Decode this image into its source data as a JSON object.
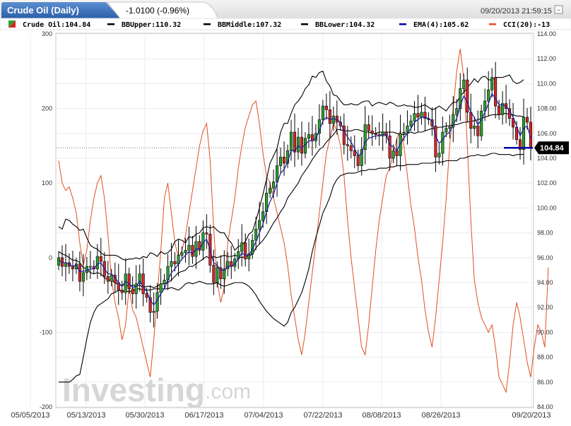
{
  "header": {
    "title": "Crude Oil (Daily)",
    "change": "-1.0100 (-0.96%)",
    "timestamp": "09/20/2013 21:59:15",
    "minimize_label": "−",
    "maximize_label": "□"
  },
  "legend": [
    {
      "label": "Crude Oil:104.84",
      "color": "#2ca02c",
      "color2": "#d62728"
    },
    {
      "label": "BBUpper:110.32",
      "color": "#000000"
    },
    {
      "label": "BBMiddle:107.32",
      "color": "#000000"
    },
    {
      "label": "BBLower:104.32",
      "color": "#000000"
    },
    {
      "label": "EMA(4):105.62",
      "color": "#0000aa"
    },
    {
      "label": "CCI(20):-13",
      "color": "#e05020"
    }
  ],
  "watermark": {
    "main": "Investing",
    "suffix": ".com"
  },
  "chart_data": {
    "type": "candlestick",
    "right_axis": {
      "ticks": [
        "114.00",
        "112.00",
        "110.00",
        "108.00",
        "106.00",
        "104.00",
        "102.00",
        "100.00",
        "98.00",
        "96.00",
        "94.00",
        "92.00",
        "90.00",
        "88.00",
        "86.00",
        "84.00"
      ],
      "range": [
        84,
        114
      ]
    },
    "left_axis": {
      "ticks": [
        "300",
        "200",
        "100",
        "0",
        "-100",
        "-200"
      ],
      "range": [
        -200,
        300
      ]
    },
    "x_ticks": [
      "05/05/2013",
      "05/13/2013",
      "05/30/2013",
      "06/17/2013",
      "07/04/2013",
      "07/22/2013",
      "08/08/2013",
      "08/26/2013",
      "09/20/2013"
    ],
    "last_price": "104.84",
    "last_price_value": 104.84,
    "last_price_color": "#0000aa",
    "colors": {
      "up": "#2ca02c",
      "down": "#d62728",
      "bb": "#000000",
      "ema": "#1a1aa0",
      "cci": "#e05020"
    },
    "series": [
      {
        "name": "Crude Oil",
        "close": [
          96.0,
          95.3,
          95.6,
          95.3,
          95.1,
          95.5,
          94.1,
          94.8,
          95.3,
          95.3,
          95.1,
          96.1,
          95.7,
          94.5,
          94.1,
          94.6,
          94.0,
          93.4,
          93.2,
          94.7,
          93.5,
          93.1,
          93.9,
          94.7,
          93.1,
          92.8,
          91.6,
          91.7,
          93.2,
          93.9,
          94.2,
          95.3,
          95.7,
          95.5,
          96.2,
          96.4,
          96.6,
          97.0,
          96.1,
          97.3,
          96.6,
          98.0,
          97.9,
          95.4,
          94.0,
          95.2,
          94.3,
          95.1,
          95.7,
          95.3,
          95.9,
          96.5,
          97.2,
          95.9,
          96.3,
          97.4,
          98.3,
          99.0,
          99.7,
          101.2,
          101.6,
          102.1,
          103.4,
          104.1,
          103.6,
          104.6,
          106.1,
          104.5,
          105.7,
          104.4,
          105.6,
          105.9,
          105.4,
          106.0,
          107.1,
          108.2,
          107.9,
          106.8,
          107.4,
          106.9,
          106.6,
          105.1,
          105.0,
          104.6,
          104.2,
          103.4,
          104.7,
          106.7,
          106.2,
          106.0,
          105.9,
          105.8,
          106.1,
          105.8,
          104.0,
          104.6,
          104.2,
          106.0,
          106.1,
          106.6,
          107.0,
          107.6,
          107.3,
          107.7,
          107.2,
          107.1,
          106.6,
          104.1,
          104.4,
          106.1,
          106.4,
          106.5,
          107.5,
          108.0,
          109.6,
          110.3,
          107.7,
          106.4,
          106.6,
          105.8,
          107.8,
          108.6,
          109.5,
          110.5,
          108.2,
          107.5,
          108.4,
          108.0,
          107.2,
          106.5,
          105.5,
          104.7,
          107.3,
          106.9,
          104.84
        ]
      },
      {
        "name": "BBUpper",
        "values": [
          98.5,
          98.3,
          99.1,
          99.0,
          98.7,
          98.5,
          98.2,
          98.3,
          97.6,
          97.0,
          96.8,
          96.7,
          96.4,
          96.2,
          96.2,
          96.2,
          96.2,
          96.1,
          95.9,
          95.8,
          95.9,
          95.9,
          96.0,
          95.9,
          96.1,
          96.0,
          96.4,
          96.3,
          96.1,
          96.5,
          96.3,
          96.4,
          96.7,
          97.3,
          97.5,
          97.4,
          97.2,
          97.7,
          97.6,
          97.9,
          98.0,
          98.4,
          98.5,
          98.4,
          98.5,
          98.2,
          98.0,
          98.0,
          97.5,
          97.2,
          96.6,
          96.9,
          97.0,
          97.3,
          97.9,
          98.1,
          99.0,
          100.0,
          101.1,
          102.3,
          103.6,
          104.2,
          104.8,
          106.1,
          106.8,
          106.8,
          107.6,
          108.3,
          108.6,
          109.0,
          109.6,
          109.9,
          110.6,
          110.5,
          110.9,
          111.0,
          110.2,
          109.8,
          109.1,
          109.0,
          108.6,
          108.3,
          108.3,
          108.4,
          108.3,
          108.3,
          108.5,
          108.6,
          108.6,
          108.2,
          108.4,
          108.5,
          108.4,
          108.3,
          108.5,
          108.4,
          108.2,
          108.2,
          108.3,
          108.2,
          108.2,
          108.1,
          108.1,
          108.2,
          108.3,
          108.1,
          107.9,
          108.0,
          108.2,
          108.0,
          107.8,
          108.2,
          108.5,
          108.5,
          109.0,
          109.3,
          109.7,
          110.0,
          110.4,
          110.1,
          110.5,
          110.6,
          110.3,
          110.3,
          110.5,
          110.5,
          110.5,
          110.6,
          110.7,
          110.2,
          110.0,
          110.1,
          110.32
        ]
      },
      {
        "name": "BBMiddle",
        "values": [
          96.5,
          96.3,
          96.2,
          96.0,
          95.8,
          95.8,
          95.6,
          95.2,
          95.1,
          94.8,
          94.7,
          94.8,
          94.7,
          94.4,
          94.2,
          94.2,
          94.0,
          93.8,
          93.8,
          93.8,
          93.7,
          93.8,
          93.7,
          93.8,
          93.6,
          93.7,
          93.7,
          93.6,
          93.7,
          93.9,
          93.9,
          94.0,
          94.2,
          94.5,
          94.8,
          94.9,
          95.0,
          95.3,
          95.3,
          95.5,
          95.7,
          95.9,
          96.1,
          95.9,
          96.1,
          96.0,
          96.1,
          96.2,
          96.1,
          96.1,
          96.2,
          96.1,
          96.0,
          96.1,
          96.1,
          96.3,
          96.8,
          97.1,
          97.4,
          97.8,
          98.3,
          98.8,
          99.2,
          99.7,
          100.1,
          100.8,
          101.2,
          101.6,
          102.0,
          102.6,
          103.0,
          103.4,
          103.9,
          104.3,
          104.7,
          104.9,
          105.3,
          105.6,
          105.9,
          106.3,
          106.3,
          106.2,
          106.2,
          106.2,
          106.3,
          106.3,
          106.2,
          106.1,
          106.1,
          106.0,
          106.0,
          106.1,
          106.1,
          106.1,
          106.1,
          106.1,
          106.0,
          105.9,
          105.9,
          106.0,
          106.1,
          106.0,
          106.1,
          106.1,
          106.2,
          106.3,
          106.4,
          106.4,
          106.5,
          106.5,
          106.6,
          106.6,
          106.7,
          106.7,
          106.8,
          106.9,
          106.9,
          107.0,
          107.0,
          107.1,
          107.2,
          107.3,
          107.4,
          107.5,
          107.5,
          107.5,
          107.6,
          107.6,
          107.5,
          107.5,
          107.4,
          107.4,
          107.32
        ]
      },
      {
        "name": "BBLower",
        "values": [
          86.0,
          86.0,
          86.0,
          86.0,
          86.2,
          86.5,
          86.6,
          88.0,
          89.5,
          90.8,
          91.6,
          92.1,
          92.3,
          92.5,
          92.7,
          93.1,
          93.2,
          93.4,
          93.3,
          93.3,
          93.3,
          93.3,
          93.5,
          93.5,
          93.4,
          93.4,
          93.4,
          93.5,
          93.5,
          93.5,
          93.5,
          93.5,
          93.6,
          93.5,
          93.4,
          93.6,
          93.9,
          94.0,
          93.9,
          94.0,
          94.1,
          94.0,
          93.9,
          93.9,
          93.9,
          94.0,
          93.8,
          93.7,
          93.8,
          93.9,
          94.0,
          94.0,
          94.0,
          93.9,
          93.7,
          93.4,
          93.0,
          92.5,
          92.1,
          91.7,
          91.4,
          91.1,
          90.9,
          90.7,
          90.5,
          90.8,
          91.6,
          92.0,
          92.6,
          93.2,
          94.1,
          95.1,
          96.5,
          97.6,
          98.6,
          99.6,
          100.2,
          100.9,
          101.8,
          102.3,
          102.6,
          102.7,
          102.8,
          102.8,
          102.8,
          102.9,
          103.0,
          103.0,
          103.1,
          103.1,
          103.1,
          103.2,
          103.2,
          103.2,
          103.3,
          103.3,
          103.4,
          103.4,
          103.4,
          103.5,
          103.5,
          103.5,
          103.5,
          103.6,
          103.6,
          103.6,
          103.6,
          103.7,
          103.7,
          103.7,
          103.8,
          103.8,
          103.8,
          103.8,
          104.0,
          104.0,
          104.1,
          104.2,
          104.2,
          104.3,
          104.2,
          104.2,
          104.3,
          104.4,
          104.4,
          104.3,
          104.3,
          104.3,
          104.3,
          104.2,
          104.3,
          104.3,
          104.32
        ]
      },
      {
        "name": "EMA(4)",
        "values": [
          95.8,
          95.6,
          95.6,
          95.5,
          95.3,
          95.4,
          94.9,
          94.9,
          95.0,
          95.1,
          95.1,
          95.5,
          95.6,
          95.1,
          94.7,
          94.7,
          94.4,
          94.0,
          93.7,
          94.1,
          93.9,
          93.6,
          93.7,
          94.1,
          93.7,
          93.3,
          92.6,
          92.2,
          92.6,
          93.1,
          93.5,
          94.2,
          94.8,
          95.1,
          95.5,
          95.9,
          96.2,
          96.5,
          96.3,
          96.7,
          96.7,
          97.2,
          97.5,
          96.6,
          95.6,
          95.4,
          95.0,
          95.0,
          95.3,
          95.3,
          95.5,
          95.9,
          96.4,
          96.2,
          96.2,
          96.7,
          97.3,
          98.0,
          98.7,
          99.7,
          100.5,
          101.1,
          102.0,
          102.8,
          103.1,
          103.7,
          104.6,
          104.6,
          105.0,
          104.8,
          105.1,
          105.4,
          105.4,
          105.6,
          106.2,
          107.0,
          107.3,
          107.1,
          107.2,
          107.1,
          106.9,
          106.2,
          105.7,
          105.3,
          104.8,
          104.2,
          104.4,
          105.3,
          105.6,
          105.7,
          105.8,
          105.8,
          105.9,
          105.9,
          105.1,
          104.9,
          104.6,
          105.2,
          105.6,
          106.0,
          106.4,
          106.9,
          107.1,
          107.3,
          107.3,
          107.2,
          107.0,
          105.8,
          105.2,
          105.5,
          105.9,
          106.1,
          106.7,
          107.2,
          108.2,
          109.0,
          108.5,
          107.7,
          107.3,
          106.7,
          107.1,
          107.7,
          108.4,
          109.2,
          108.8,
          108.3,
          108.3,
          108.2,
          107.8,
          107.3,
          106.6,
          105.8,
          106.4,
          106.6,
          105.62
        ]
      },
      {
        "name": "CCI(20)",
        "values": [
          130,
          100,
          90,
          95,
          80,
          60,
          20,
          -10,
          10,
          50,
          80,
          100,
          110,
          80,
          30,
          -30,
          -60,
          -80,
          -110,
          -90,
          -40,
          -70,
          -80,
          -100,
          -120,
          -140,
          -160,
          -110,
          -50,
          10,
          80,
          100,
          60,
          20,
          0,
          10,
          30,
          60,
          90,
          120,
          150,
          170,
          180,
          130,
          40,
          -30,
          -60,
          -40,
          20,
          50,
          80,
          120,
          150,
          175,
          190,
          205,
          210,
          180,
          140,
          110,
          100,
          80,
          60,
          40,
          20,
          -10,
          -50,
          -80,
          -110,
          -130,
          -100,
          -60,
          -20,
          20,
          60,
          100,
          140,
          160,
          180,
          170,
          150,
          110,
          50,
          0,
          -40,
          -80,
          -120,
          -130,
          -90,
          -40,
          10,
          50,
          80,
          110,
          120,
          140,
          160,
          170,
          150,
          110,
          70,
          40,
          0,
          -30,
          -70,
          -100,
          -120,
          -80,
          -30,
          20,
          80,
          150,
          200,
          250,
          280,
          240,
          150,
          50,
          -30,
          -60,
          -80,
          -90,
          -100,
          -90,
          -120,
          -160,
          -170,
          -180,
          -140,
          -90,
          -60,
          -80,
          -110,
          -140,
          -160,
          -120,
          -90,
          -100,
          -120,
          -13
        ]
      }
    ]
  }
}
